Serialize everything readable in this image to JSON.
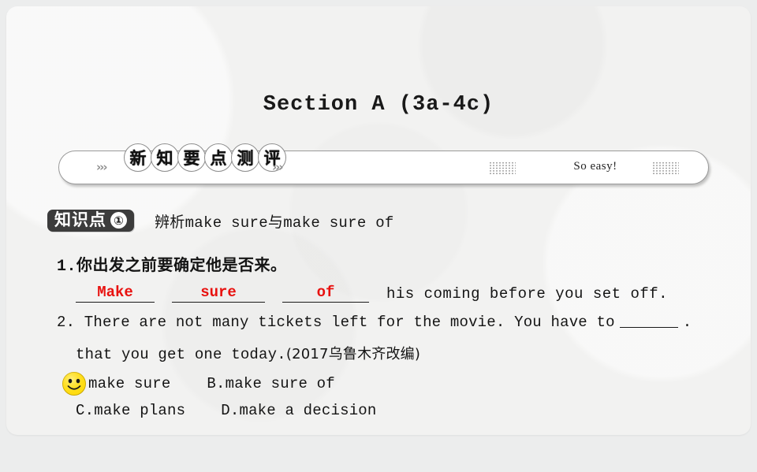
{
  "slide": {
    "title": "Section A (3a-4c)",
    "banner": {
      "bubbles": [
        "新",
        "知",
        "要",
        "点",
        "测",
        "评"
      ],
      "chevron_left": "›››",
      "chevron_right": "›››",
      "tagline": "So easy!"
    },
    "knowledge_point": {
      "badge_text": "知识点",
      "badge_number": "①",
      "title": "辨析make sure与make sure of"
    },
    "question1": {
      "number": "1.",
      "prompt_cn": "你出发之前要确定他是否来。",
      "blanks": [
        "Make",
        "sure",
        "of"
      ],
      "tail": "his coming before you set off.",
      "answer_color": "#e8110f"
    },
    "question2": {
      "line1_before": "2. There are not many tickets left for the movie. You have to",
      "line1_after": ".",
      "line2": "that you get one today.",
      "source": "(2017乌鲁木齐改编)",
      "options": [
        {
          "marker": "smiley-icon",
          "label": "make sure",
          "correct": true
        },
        {
          "marker": "B.",
          "label": "make sure of",
          "correct": false
        },
        {
          "marker": "C.",
          "label": "make plans",
          "correct": false
        },
        {
          "marker": "D.",
          "label": "make a decision",
          "correct": false
        }
      ]
    }
  }
}
